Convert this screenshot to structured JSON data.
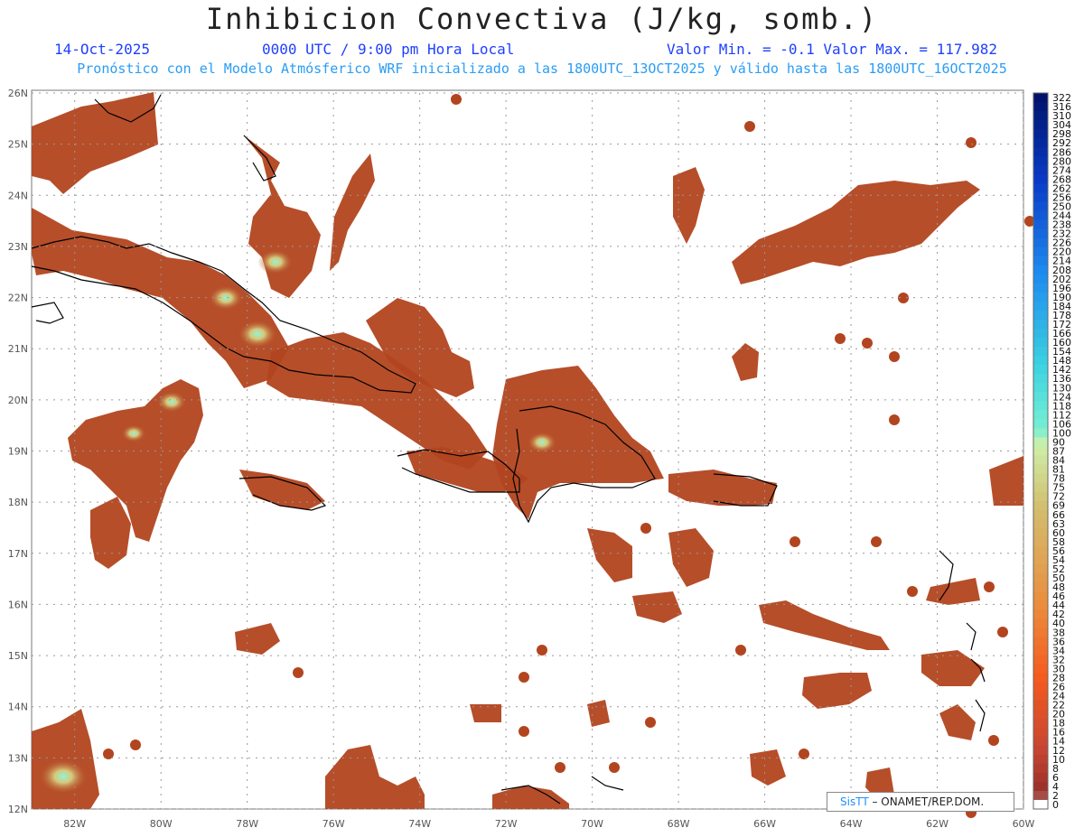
{
  "header": {
    "title": "Inhibicion Convectiva (J/kg, somb.)",
    "date": "14-Oct-2025",
    "time": "0000 UTC / 9:00 pm Hora Local",
    "minmax": "Valor Min. = -0.1  Valor Max. = 117.982",
    "model_line": "Pronóstico con el Modelo Atmósferico WRF inicializado a las 1800UTC_13OCT2025 y válido hasta las  1800UTC_16OCT2025"
  },
  "axes": {
    "lat_labels": [
      "26N",
      "25N",
      "24N",
      "23N",
      "22N",
      "21N",
      "20N",
      "19N",
      "18N",
      "17N",
      "16N",
      "15N",
      "14N",
      "13N",
      "12N"
    ],
    "lon_labels": [
      "82W",
      "80W",
      "78W",
      "76W",
      "74W",
      "72W",
      "70W",
      "68W",
      "66W",
      "64W",
      "62W",
      "60W"
    ]
  },
  "colorbar": {
    "labels": [
      "322",
      "316",
      "310",
      "304",
      "298",
      "292",
      "286",
      "280",
      "274",
      "268",
      "262",
      "256",
      "250",
      "244",
      "238",
      "232",
      "226",
      "220",
      "214",
      "208",
      "202",
      "196",
      "190",
      "184",
      "178",
      "172",
      "166",
      "160",
      "154",
      "148",
      "142",
      "136",
      "130",
      "124",
      "118",
      "112",
      "106",
      "100",
      "90",
      "87",
      "84",
      "81",
      "78",
      "75",
      "72",
      "69",
      "66",
      "63",
      "60",
      "58",
      "56",
      "54",
      "52",
      "50",
      "48",
      "46",
      "44",
      "42",
      "40",
      "38",
      "36",
      "34",
      "32",
      "30",
      "28",
      "26",
      "24",
      "22",
      "20",
      "18",
      "16",
      "14",
      "12",
      "10",
      "8",
      "6",
      "4",
      "2",
      "0"
    ],
    "field_color": "#b2451f",
    "low_color": "#8e2f1f",
    "high_color": "#7ff2d2"
  },
  "credit": {
    "brand": "SisTT",
    "org": "– ONAMET/REP.DOM."
  }
}
